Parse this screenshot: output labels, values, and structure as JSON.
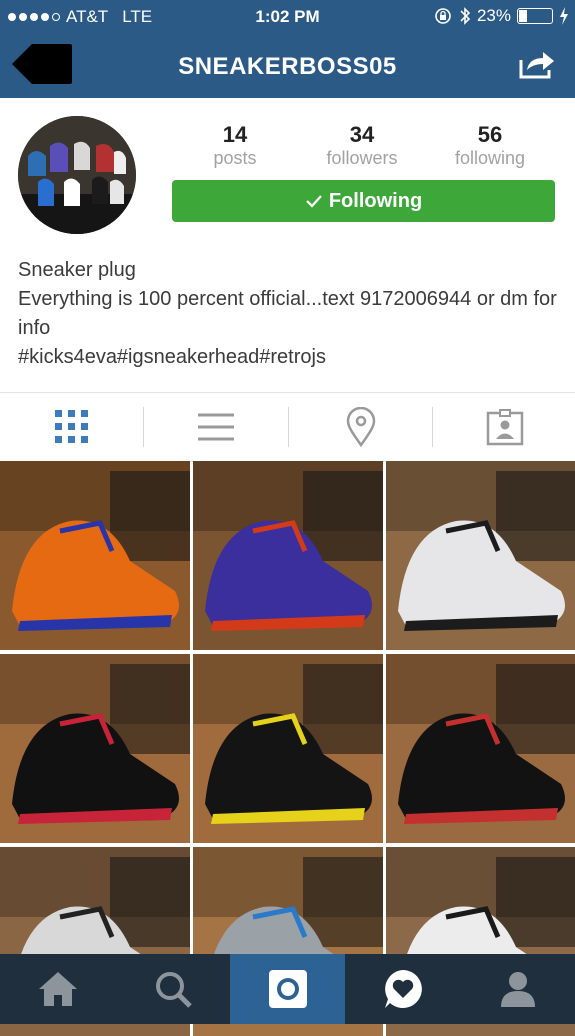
{
  "status_bar": {
    "carrier": "AT&T",
    "network": "LTE",
    "time": "1:02 PM",
    "battery": "23%",
    "battery_level": 0.23
  },
  "header": {
    "username": "SNEAKERBOSS05"
  },
  "stats": [
    {
      "count": "14",
      "label": "posts"
    },
    {
      "count": "34",
      "label": "followers"
    },
    {
      "count": "56",
      "label": "following"
    }
  ],
  "follow_button": {
    "label": "Following",
    "color": "#3ea73a"
  },
  "bio": {
    "name": "Sneaker plug",
    "line1": "Everything is 100 percent official...text 9172006944 or dm for info",
    "hashtags": "#kicks4eva#igsneakerhead#retrojs"
  },
  "view_tabs": [
    "grid-icon",
    "list-icon",
    "location-pin-icon",
    "tagged-photos-icon"
  ],
  "photos": [
    {
      "name": "orange-blue-foamposite",
      "bg": "#8a5a2e",
      "shoe": "#e66a12",
      "accent": "#2835a8"
    },
    {
      "name": "purple-retro-8",
      "bg": "#7b5531",
      "shoe": "#3a2f9c",
      "accent": "#d33a1a"
    },
    {
      "name": "white-grey-retro-13",
      "bg": "#8d6a45",
      "shoe": "#e6e6e8",
      "accent": "#1c1c1c"
    },
    {
      "name": "black-red-retro-11",
      "bg": "#a06b3c",
      "shoe": "#111111",
      "accent": "#c7243a"
    },
    {
      "name": "black-yellow-retro-14",
      "bg": "#a16c3d",
      "shoe": "#141414",
      "accent": "#e6d21a"
    },
    {
      "name": "black-retro-8",
      "bg": "#9a6a40",
      "shoe": "#121212",
      "accent": "#c43030"
    },
    {
      "name": "white-box-sneaker",
      "bg": "#8a6644",
      "shoe": "#d8d8d8",
      "accent": "#222222"
    },
    {
      "name": "grey-blue-retro-10",
      "bg": "#a57444",
      "shoe": "#9aa2a8",
      "accent": "#2b79c9"
    },
    {
      "name": "white-black-retro-10",
      "bg": "#8c6a49",
      "shoe": "#ececec",
      "accent": "#1a1a1a"
    }
  ],
  "tab_bar": [
    "home-icon",
    "search-icon",
    "camera-icon",
    "activity-icon",
    "profile-icon"
  ],
  "colors": {
    "header_blue": "#2b5a86",
    "tabbar_dark": "#1f2f3d",
    "tabbar_active": "#2d6394",
    "tab_active_blue": "#3d7bbd"
  }
}
